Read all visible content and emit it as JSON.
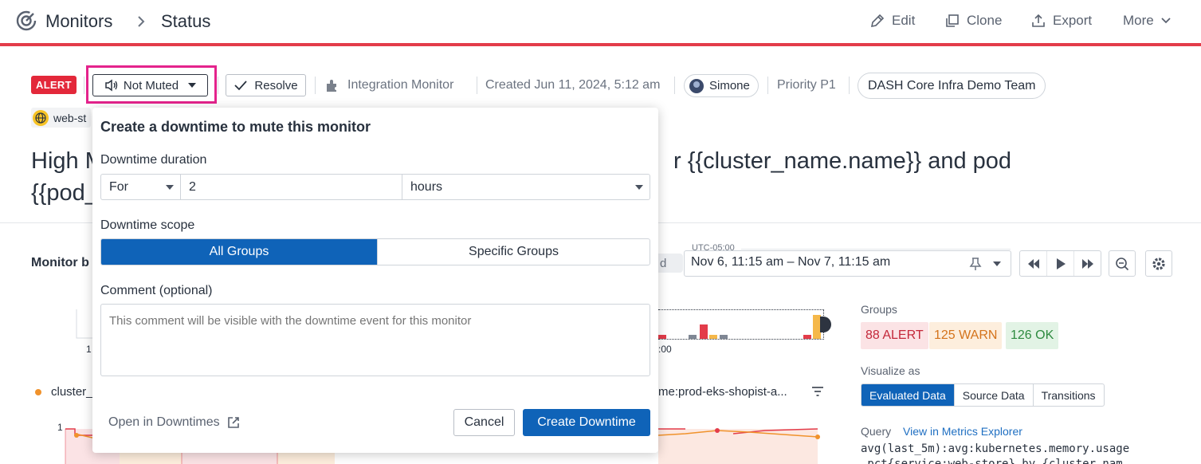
{
  "header": {
    "breadcrumb_root": "Monitors",
    "breadcrumb_current": "Status",
    "actions": {
      "edit": "Edit",
      "clone": "Clone",
      "export": "Export",
      "more": "More"
    },
    "accent_color": "#e33c4a"
  },
  "meta": {
    "status_badge": "ALERT",
    "mute_button": "Not Muted",
    "resolve_button": "Resolve",
    "monitor_type": "Integration Monitor",
    "created": "Created Jun 11, 2024, 5:12 am",
    "user": "Simone",
    "priority": "Priority P1",
    "team": "DASH Core Infra Demo Team",
    "service_tag": "web-st"
  },
  "title": {
    "line1_start": "High M",
    "line1_end": "r {{cluster_name.name}} and pod",
    "line2_start": "{{pod_"
  },
  "monitor": {
    "section_title": "Monitor b",
    "timezone": "UTC-05:00",
    "time_pill": "d",
    "time_range": "Nov 6, 11:15 am – Nov 7, 11:15 am",
    "mini_axis_label": ":00",
    "cluster_label": "cluster_",
    "cluster_right": "me:prod-eks-shopist-a...",
    "main_axis_value": "1",
    "left_axis_frag": "1"
  },
  "groups": {
    "label": "Groups",
    "alert": "88 ALERT",
    "warn": "125 WARN",
    "ok": "126 OK"
  },
  "visualize": {
    "label": "Visualize as",
    "options": [
      "Evaluated Data",
      "Source Data",
      "Transitions"
    ],
    "active": "Evaluated Data"
  },
  "query": {
    "label": "Query",
    "link": "View in Metrics Explorer",
    "line1": "avg(last_5m):avg:kubernetes.memory.usage",
    "line2": ".pct{service:web-store} by {cluster_nam"
  },
  "popover": {
    "title": "Create a downtime to mute this monitor",
    "duration_label": "Downtime duration",
    "duration_mode": "For",
    "duration_value": "2",
    "duration_unit": "hours",
    "scope_label": "Downtime scope",
    "scope_all": "All Groups",
    "scope_specific": "Specific Groups",
    "comment_label": "Comment (optional)",
    "comment_placeholder": "This comment will be visible with the downtime event for this monitor",
    "open_link": "Open in Downtimes",
    "cancel": "Cancel",
    "create": "Create Downtime",
    "primary_color": "#0f63b8"
  }
}
